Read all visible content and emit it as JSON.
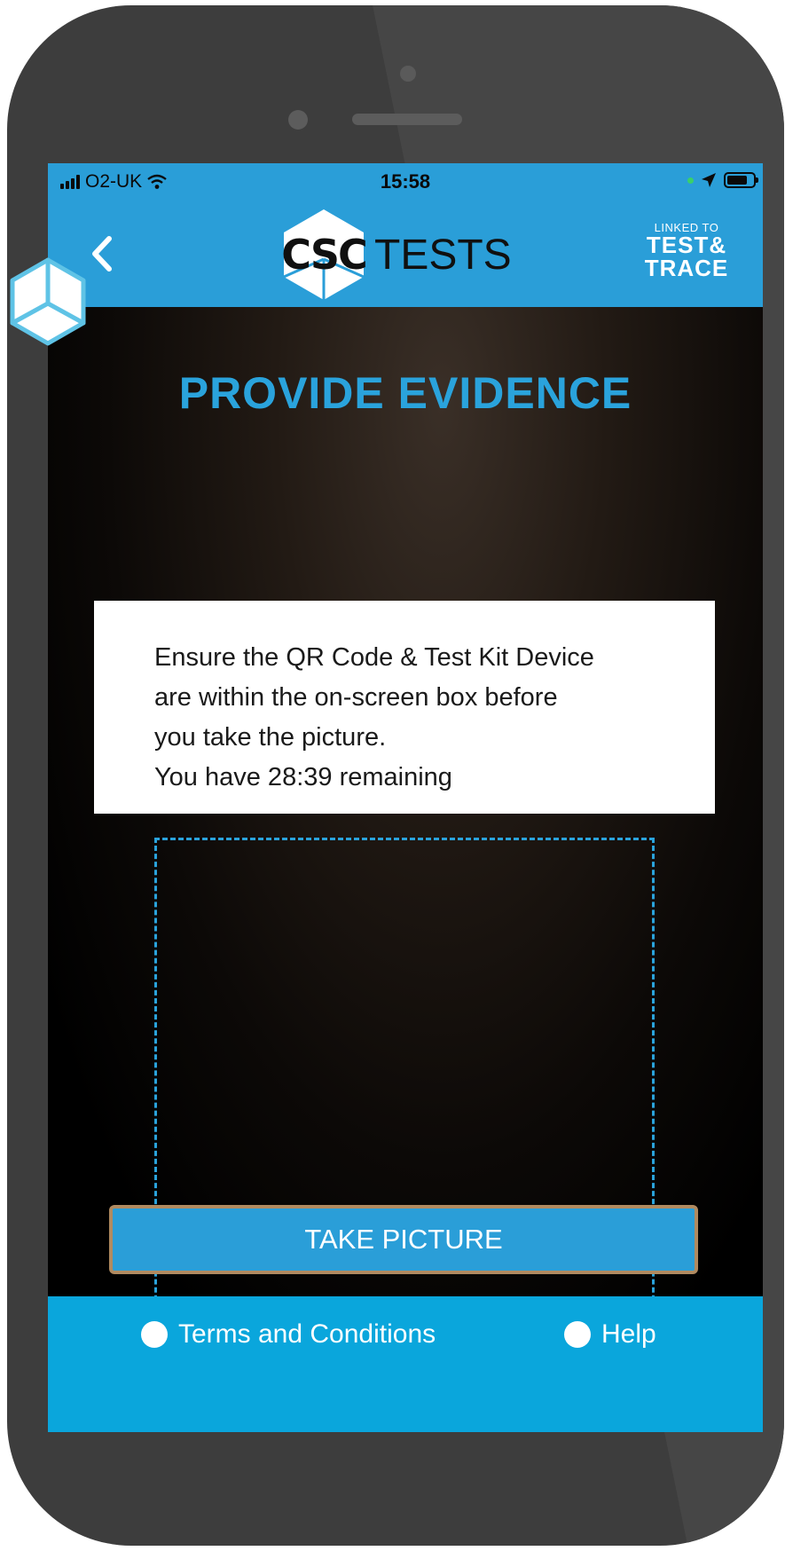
{
  "status_bar": {
    "carrier": "O2-UK",
    "time": "15:58"
  },
  "nav": {
    "logo_mark": "CSC",
    "logo_word": "TESTS",
    "badge_line1": "LINKED TO",
    "badge_line2": "TEST&",
    "badge_line3": "TRACE"
  },
  "main": {
    "heading": "PROVIDE EVIDENCE",
    "instructions": [
      "Ensure the QR Code & Test Kit Device",
      "are within the on-screen box before",
      "you take the picture.",
      "You have 28:39 remaining"
    ],
    "take_picture_label": "TAKE PICTURE"
  },
  "footer": {
    "terms_label": "Terms and Conditions",
    "help_label": "Help"
  },
  "colors": {
    "brand_blue": "#2a9ed8",
    "heading_blue": "#2aa3dc",
    "footer_blue": "#0aa6dc",
    "button_border": "#b08a60"
  },
  "icons": [
    "back-chevron-icon",
    "wifi-icon",
    "location-arrow-icon",
    "battery-icon",
    "cube-icon"
  ]
}
